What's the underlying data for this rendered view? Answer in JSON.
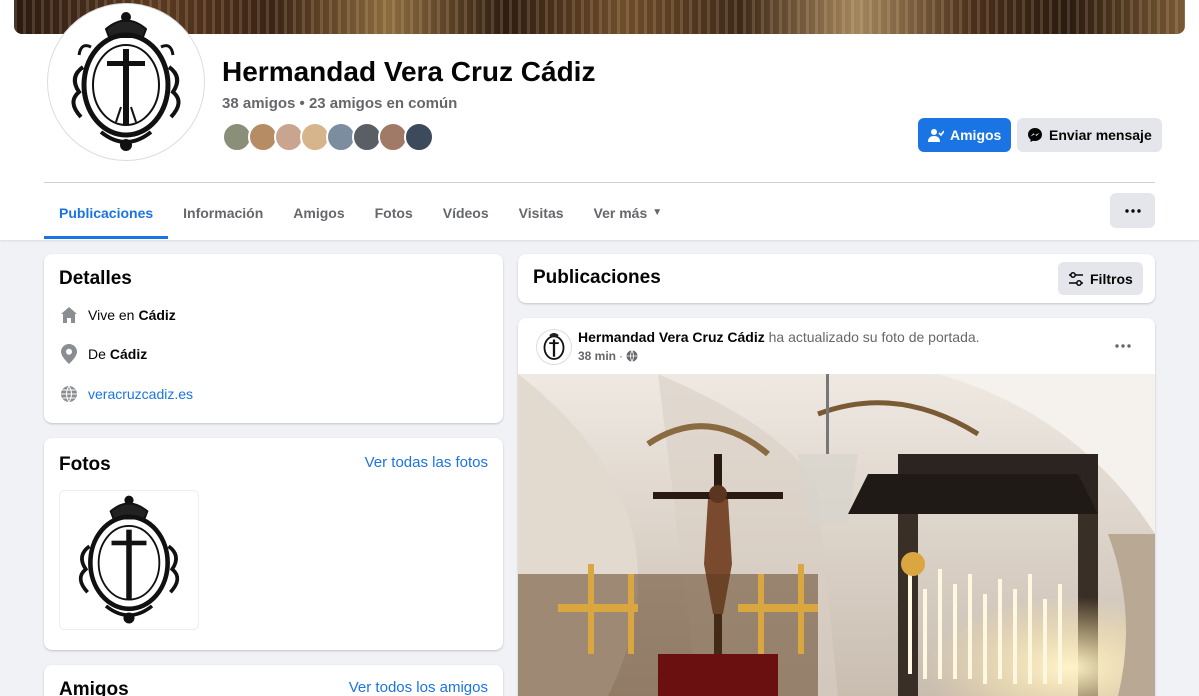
{
  "profile": {
    "name": "Hermandad Vera Cruz Cádiz",
    "friends_summary": "38 amigos • 23 amigos en común",
    "mutual_avatar_colors": [
      "#8a8f7a",
      "#b58c63",
      "#c9a590",
      "#d6b58a",
      "#7c8da0",
      "#5a5f66",
      "#a07a66",
      "#3d4a5c"
    ]
  },
  "actions": {
    "friends_label": "Amigos",
    "message_label": "Enviar mensaje"
  },
  "tabs": [
    {
      "label": "Publicaciones"
    },
    {
      "label": "Información"
    },
    {
      "label": "Amigos"
    },
    {
      "label": "Fotos"
    },
    {
      "label": "Vídeos"
    },
    {
      "label": "Visitas"
    },
    {
      "label": "Ver más"
    }
  ],
  "details": {
    "title": "Detalles",
    "lives_prefix": "Vive en",
    "lives_place": "Cádiz",
    "from_prefix": "De",
    "from_place": "Cádiz",
    "website": "veracruzcadiz.es"
  },
  "photos": {
    "title": "Fotos",
    "see_all": "Ver todas las fotos"
  },
  "friends_card": {
    "title": "Amigos",
    "see_all": "Ver todos los amigos"
  },
  "posts_header": {
    "title": "Publicaciones",
    "filters_label": "Filtros"
  },
  "post": {
    "author": "Hermandad Vera Cruz Cádiz",
    "action": "ha actualizado su foto de portada.",
    "time": "38 min",
    "separator": "·"
  },
  "colors": {
    "accent": "#1b74e4",
    "background": "#f0f2f5",
    "secondary_button": "#e4e6eb",
    "muted_text": "#65676b"
  }
}
